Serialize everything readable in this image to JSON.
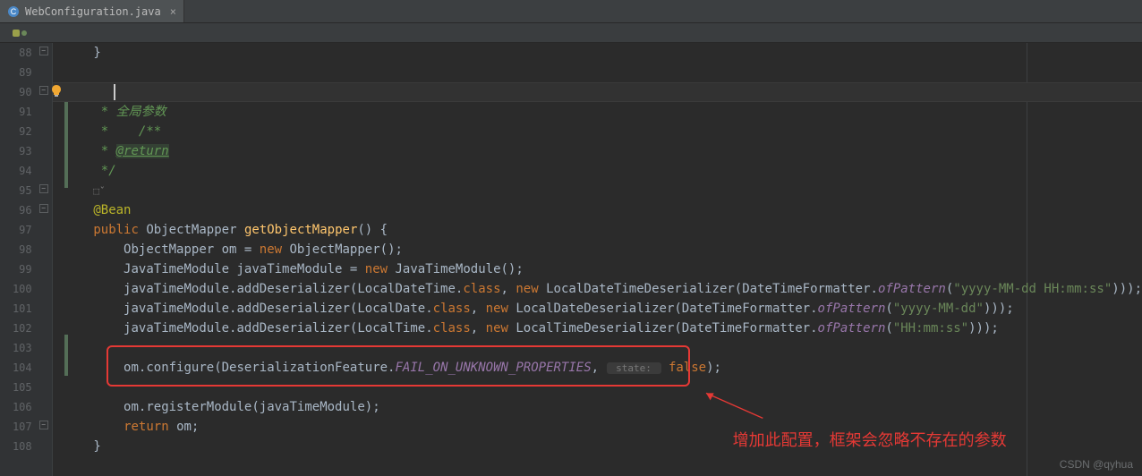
{
  "tab": {
    "filename": "WebConfiguration.java"
  },
  "gutter": {
    "start": 88,
    "end": 108
  },
  "code": {
    "l88": "    }",
    "l89": "",
    "l90_pre": "    /**",
    "l91": "     * 全局参数",
    "l92": "     *",
    "l93_pre": "     * ",
    "l93_tag": "@return",
    "l94": "     */",
    "bean": "@Bean",
    "pub": "public ",
    "om_type": "ObjectMapper ",
    "get_m": "getObjectMapper",
    "paren": "() {",
    "l97_a": "        ObjectMapper om = ",
    "l97_new": "new ",
    "l97_b": "ObjectMapper();",
    "l98_a": "        JavaTimeModule javaTimeModule = ",
    "l98_new": "new ",
    "l98_b": "JavaTimeModule();",
    "l99_a": "        javaTimeModule.addDeserializer(LocalDateTime.",
    "l99_cls": "class",
    "l99_c": ", ",
    "l99_new": "new ",
    "l99_d": "LocalDateTimeDeserializer(DateTimeFormatter.",
    "l99_ofp": "ofPattern",
    "l99_e": "(",
    "l99_str": "\"yyyy-MM-dd HH:mm:ss\"",
    "l99_f": ")));",
    "l100_a": "        javaTimeModule.addDeserializer(LocalDate.",
    "l100_cls": "class",
    "l100_c": ", ",
    "l100_new": "new ",
    "l100_d": "LocalDateDeserializer(DateTimeFormatter.",
    "l100_ofp": "ofPattern",
    "l100_e": "(",
    "l100_str": "\"yyyy-MM-dd\"",
    "l100_f": ")));",
    "l101_a": "        javaTimeModule.addDeserializer(LocalTime.",
    "l101_cls": "class",
    "l101_c": ", ",
    "l101_new": "new ",
    "l101_d": "LocalTimeDeserializer(DateTimeFormatter.",
    "l101_ofp": "ofPattern",
    "l101_e": "(",
    "l101_str": "\"HH:mm:ss\"",
    "l101_f": ")));",
    "l103_a": "        om.configure(DeserializationFeature.",
    "l103_prop": "FAIL_ON_UNKNOWN_PROPERTIES",
    "l103_c": ", ",
    "l103_hint": " state: ",
    "l103_false": "false",
    "l103_end": ");",
    "l105": "        om.registerModule(javaTimeModule);",
    "l106_a": "        ",
    "l106_ret": "return ",
    "l106_b": "om;",
    "l107": "    }"
  },
  "annotation": "增加此配置，框架会忽略不存在的参数",
  "watermark": "CSDN @qyhua"
}
